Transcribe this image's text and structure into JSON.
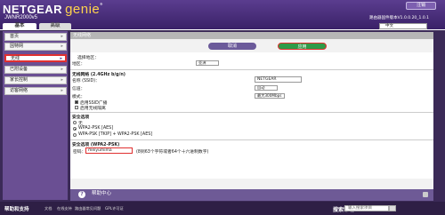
{
  "header": {
    "brand": "NETGEAR",
    "brand_genie": "genie",
    "brand_reg": "®",
    "model": "JWNR2000v5",
    "logout": "注销",
    "firmware": "路由器固件版本V1.0.0.20_1.0.1",
    "language": "中文"
  },
  "tabs": {
    "basic": "基本",
    "advanced": "高级"
  },
  "sidebar": {
    "items": [
      {
        "label": "首页"
      },
      {
        "label": "因特网"
      },
      {
        "label": "无线"
      },
      {
        "label": "已附设备"
      },
      {
        "label": "家长控制"
      },
      {
        "label": "访客网络"
      }
    ]
  },
  "main": {
    "title": "无线网络",
    "cancel": "取消",
    "apply": "应用",
    "region_section": "选择地区：",
    "region_label": "地区：",
    "region_value": "亚洲",
    "wifi_section": "无线网络 (2.4GHz b/g/n)",
    "ssid_label": "名称 (SSID)：",
    "ssid_value": "NETGEAR",
    "channel_label": "信道：",
    "channel_value": "自动",
    "mode_label": "模式：",
    "mode_value": "最大300Mbps",
    "ssid_broadcast": "启用SSID广播",
    "isolation": "启用无线隔离",
    "security_section": "安全选项",
    "sec_none": "无",
    "sec_wpa2": "WPA2-PSK [AES]",
    "sec_mixed": "WPA-PSK [TKIP] + WPA2-PSK [AES]",
    "sec_opts_section": "安全选项 (WPA2-PSK)",
    "pwd_label": "密码：",
    "pwd_value": "meiyumima",
    "pwd_hint": "(8到63个字符或者64个十六进制数字)",
    "help": "帮助中心"
  },
  "footer": {
    "support": "帮助和支持",
    "links": [
      "文档",
      "在线支持",
      "路由器常见问题",
      "GPL许可证"
    ],
    "search_label": "搜索帮助",
    "search_placeholder": "输入搜索项目"
  }
}
